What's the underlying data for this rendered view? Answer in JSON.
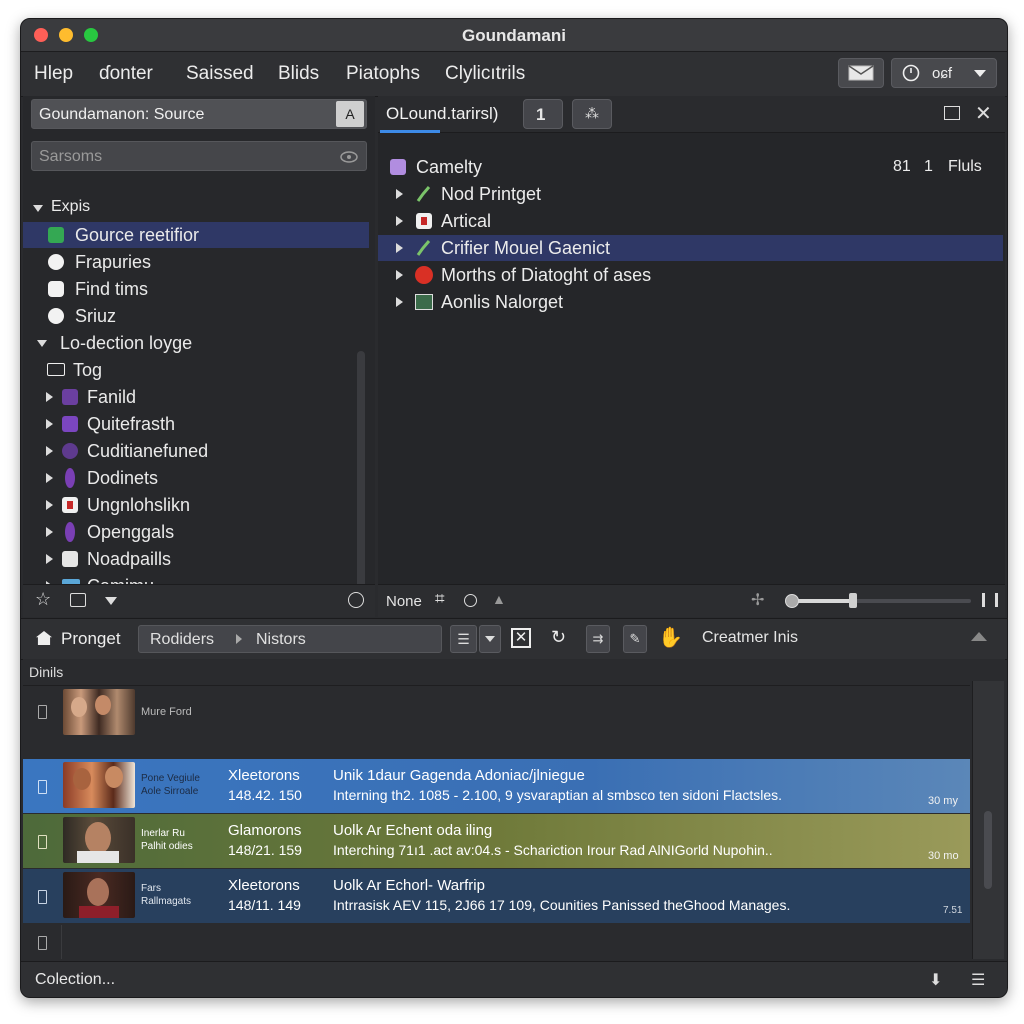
{
  "window": {
    "title": "Goundamani"
  },
  "menu": {
    "items": [
      "Hlep",
      "ɗonter",
      "Saissed",
      "Blids",
      "Piatophs",
      "Clylicıtrils"
    ]
  },
  "toolbar": {
    "mail_label": "",
    "clock_button_label": "oɕf"
  },
  "source_panel": {
    "header": "Goundamanon: Source",
    "search_placeholder": "Sarsoms",
    "group1_label": "Expis",
    "group1_items": [
      "Gource reetifior",
      "Frapuries",
      "Find tims",
      "Sriuz"
    ],
    "group2_label": "Lo-dection loyge",
    "group2_items": [
      "Tog",
      "Fanild",
      "Quitefrasth",
      "Cuditianefuned",
      "Dodinets",
      "Ungnlohslikn",
      "Openggals",
      "Noadpaills",
      "Camimu"
    ]
  },
  "detail_panel": {
    "tab_label": "OLound.tarirsl)",
    "tab_count": "1",
    "header_label": "Camelty",
    "header_num1": "81",
    "header_num2": "1",
    "header_right": "Fluls",
    "items": [
      "Nod Printget",
      "Artical",
      "Crifier Mouel Gaenict",
      "Morths of Diatoght of ases",
      "Aonlis Nalorget"
    ],
    "footer_label": "None"
  },
  "lower_toolbar": {
    "home_label": "Pronget",
    "crumb1": "Rodiders",
    "crumb2": "Nistors",
    "right_label": "Creatmer Inis"
  },
  "list": {
    "header": "Dinils",
    "rows": [
      {
        "thumb_caption": "Mure Ford",
        "top_small": "",
        "bottom_small": "",
        "col1_top": "",
        "col1_bottom": "",
        "col2_top": "",
        "col2_bottom": "",
        "right": ""
      },
      {
        "thumb_caption": "",
        "top_small": "Pone Vegiule",
        "bottom_small": "Aole Sirroale",
        "col1_top": "Xleetorons",
        "col1_bottom": "148.42. 150",
        "col2_top": "Unik 1daur Gagenda Adoniac/jlniegue",
        "col2_bottom": "Interning th2. 1085 - 2.100, 9 ysvaraptian al smbsco ten sidoni Flactsles.",
        "right": "30 my"
      },
      {
        "thumb_caption": "",
        "top_small": "Inerlar Ru",
        "bottom_small": "Palhit odies",
        "col1_top": "Glamorons",
        "col1_bottom": "148/21. 159",
        "col2_top": "Uolk Ar Echent oda iling",
        "col2_bottom": "Interching 71ı1 .act av:04.s - Schariction Irour Rad AlNIGorld Nupohin..",
        "right": "30 mo"
      },
      {
        "thumb_caption": "",
        "top_small": "Fars",
        "bottom_small": "Rallmagats",
        "col1_top": "Xleetorons",
        "col1_bottom": "148/11. 149",
        "col2_top": "Uolk Ar Echorl- Warfrip",
        "col2_bottom": "Intrrasisk AEV 115, 2J66 17 109, Counities Panissed theGhood Manages.",
        "right": "7.51"
      }
    ]
  },
  "status": {
    "text": "Colection..."
  },
  "colors": {
    "selection": "#2f3866",
    "row_blue": "#3a6fb4",
    "row_green": "#6f7a3a",
    "row_navy": "#28405e"
  }
}
